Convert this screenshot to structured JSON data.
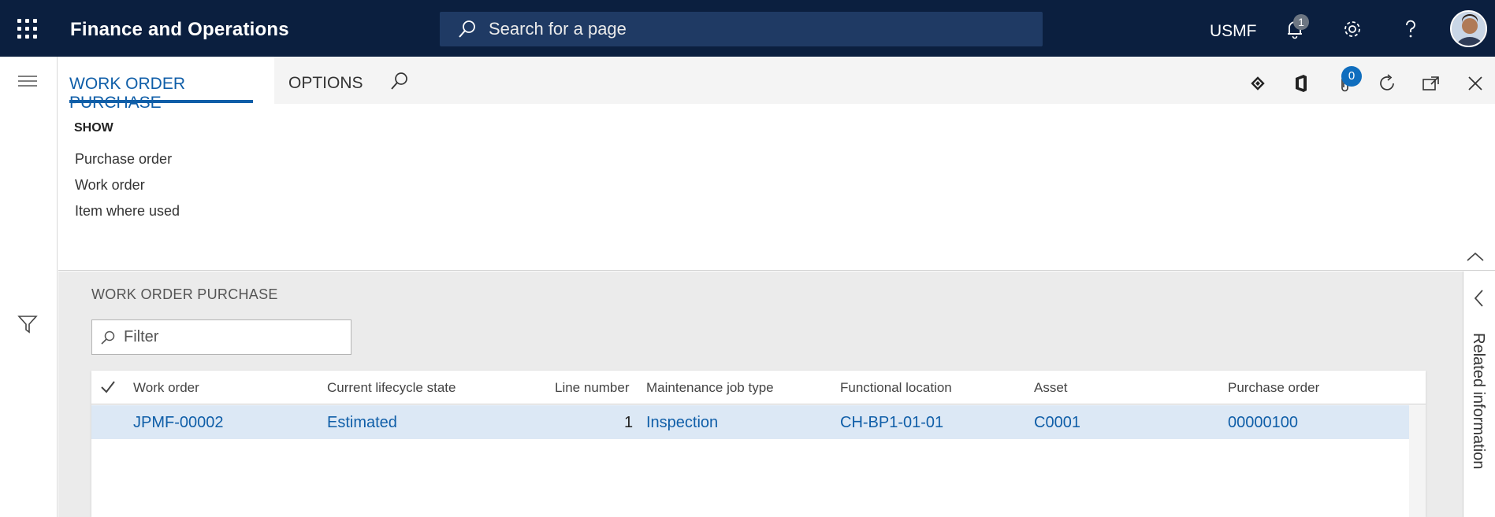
{
  "topbar": {
    "app_title": "Finance and Operations",
    "search_placeholder": "Search for a page",
    "company": "USMF",
    "notification_count": "1"
  },
  "action_pane": {
    "tabs": [
      {
        "label": "WORK ORDER PURCHASE",
        "active": true
      },
      {
        "label": "OPTIONS",
        "active": false
      }
    ],
    "attachment_count": "0",
    "group": {
      "title": "SHOW",
      "items": [
        "Purchase order",
        "Work order",
        "Item where used"
      ]
    }
  },
  "main": {
    "section_title": "WORK ORDER PURCHASE",
    "filter_placeholder": "Filter",
    "columns": [
      "Work order",
      "Current lifecycle state",
      "Line number",
      "Maintenance job type",
      "Functional location",
      "Asset",
      "Purchase order"
    ],
    "rows": [
      {
        "work_order": "JPMF-00002",
        "lifecycle_state": "Estimated",
        "line_number": "1",
        "job_type": "Inspection",
        "functional_location": "CH-BP1-01-01",
        "asset": "C0001",
        "purchase_order": "00000100"
      }
    ]
  },
  "related_pane": {
    "label": "Related information"
  },
  "colors": {
    "nav_bg": "#0b1f3f",
    "accent": "#0f5ea8",
    "selected_row": "#dce8f5"
  }
}
